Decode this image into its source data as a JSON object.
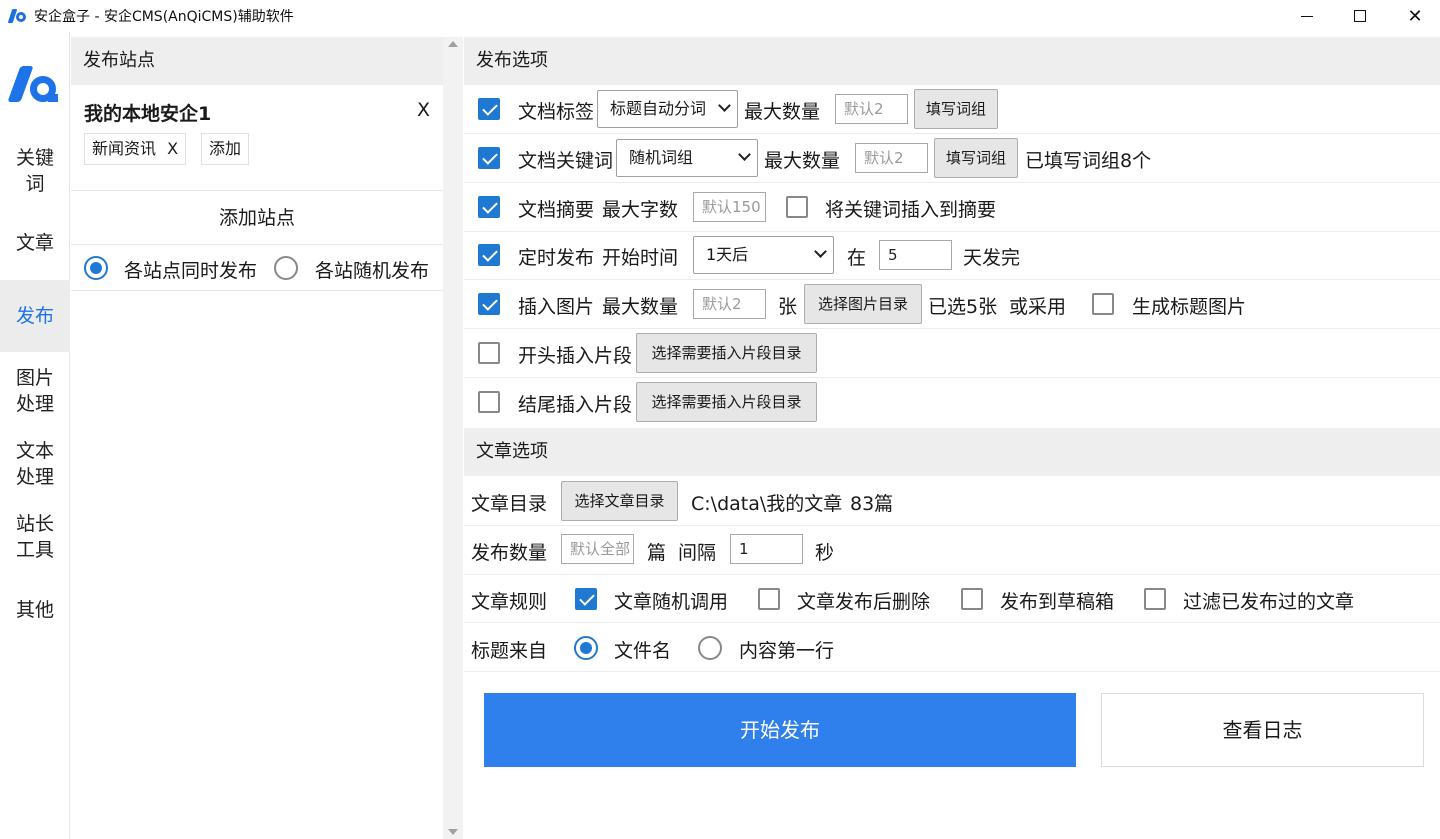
{
  "window": {
    "title": "安企盒子 - 安企CMS(AnQiCMS)辅助软件"
  },
  "nav": {
    "items": [
      {
        "label_lines": [
          "关键",
          "词"
        ]
      },
      {
        "label_lines": [
          "文章"
        ]
      },
      {
        "label_lines": [
          "发布"
        ]
      },
      {
        "label_lines": [
          "图片",
          "处理"
        ]
      },
      {
        "label_lines": [
          "文本",
          "处理"
        ]
      },
      {
        "label_lines": [
          "站长",
          "工具"
        ]
      },
      {
        "label_lines": [
          "其他"
        ]
      }
    ],
    "active_index": 2,
    "accent": "#1e73e8"
  },
  "sites": {
    "header": "发布站点",
    "site_name": "我的本地安企1",
    "site_close": "X",
    "tags": [
      {
        "label": "新闻资讯",
        "remove": "X"
      }
    ],
    "add_tag": "添加",
    "add_site": "添加站点",
    "publish_mode": {
      "options": [
        "各站点同时发布",
        "各站随机发布"
      ],
      "selected_index": 0
    }
  },
  "publish_options": {
    "header": "发布选项",
    "tags": {
      "checked": true,
      "label": "文档标签",
      "select": "标题自动分词",
      "max_label": "最大数量",
      "max_placeholder": "默认2",
      "button": "填写词组"
    },
    "keywords": {
      "checked": true,
      "label": "文档关键词",
      "select": "随机词组",
      "max_label": "最大数量",
      "max_placeholder": "默认2",
      "button": "填写词组",
      "status": "已填写词组8个"
    },
    "summary": {
      "checked": true,
      "label": "文档摘要",
      "max_label": "最大字数",
      "max_placeholder": "默认150",
      "insert_checked": false,
      "insert_label": "将关键词插入到摘要"
    },
    "schedule": {
      "checked": true,
      "label": "定时发布",
      "start_label": "开始时间",
      "select": "1天后",
      "in_label": "在",
      "days_value": "5",
      "suffix": "天发完"
    },
    "images": {
      "checked": true,
      "label": "插入图片",
      "max_label": "最大数量",
      "max_placeholder": "默认2",
      "unit": "张",
      "button": "选择图片目录",
      "status": "已选5张",
      "or_label": "或采用",
      "gen_checked": false,
      "gen_label": "生成标题图片"
    },
    "head_snippet": {
      "checked": false,
      "label": "开头插入片段",
      "button": "选择需要插入片段目录"
    },
    "tail_snippet": {
      "checked": false,
      "label": "结尾插入片段",
      "button": "选择需要插入片段目录"
    }
  },
  "article_options": {
    "header": "文章选项",
    "dir": {
      "label": "文章目录",
      "button": "选择文章目录",
      "path": "C:\\data\\我的文章",
      "count": "83篇"
    },
    "count": {
      "label": "发布数量",
      "placeholder": "默认全部",
      "unit": "篇",
      "interval_label": "间隔",
      "interval_value": "1",
      "interval_unit": "秒"
    },
    "rules": {
      "label": "文章规则",
      "items": [
        {
          "label": "文章随机调用",
          "checked": true
        },
        {
          "label": "文章发布后删除",
          "checked": false
        },
        {
          "label": "发布到草稿箱",
          "checked": false
        },
        {
          "label": "过滤已发布过的文章",
          "checked": false
        }
      ]
    },
    "title_from": {
      "label": "标题来自",
      "options": [
        "文件名",
        "内容第一行"
      ],
      "selected_index": 0
    }
  },
  "actions": {
    "start": "开始发布",
    "log": "查看日志",
    "primary_color": "#2f80ed"
  }
}
